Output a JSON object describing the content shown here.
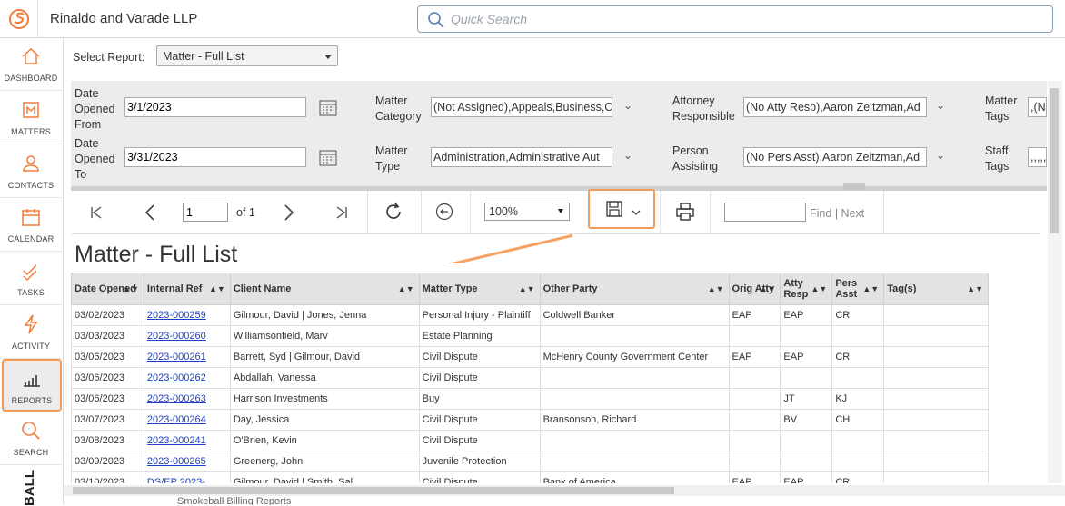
{
  "app": {
    "firm_name": "Rinaldo and Varade LLP",
    "search_placeholder": "Quick Search",
    "brand_vertical": "BALL"
  },
  "nav": [
    {
      "label": "DASHBOARD",
      "icon": "home-icon"
    },
    {
      "label": "MATTERS",
      "icon": "matters-icon"
    },
    {
      "label": "CONTACTS",
      "icon": "contacts-icon"
    },
    {
      "label": "CALENDAR",
      "icon": "calendar-icon"
    },
    {
      "label": "TASKS",
      "icon": "tasks-icon"
    },
    {
      "label": "ACTIVITY",
      "icon": "activity-icon"
    },
    {
      "label": "REPORTS",
      "icon": "reports-icon",
      "active": true
    },
    {
      "label": "SEARCH",
      "icon": "search-icon"
    }
  ],
  "report": {
    "select_label": "Select Report:",
    "selected": "Matter - Full List",
    "title": "Matter - Full List"
  },
  "filters": {
    "date_from_label": "Date Opened From",
    "date_from": "3/1/2023",
    "date_to_label": "Date Opened To",
    "date_to": "3/31/2023",
    "category_label": "Matter Category",
    "category": "(Not Assigned),Appeals,Business,C",
    "type_label": "Matter Type",
    "type": "Administration,Administrative Aut",
    "attorney_label": "Attorney Responsible",
    "attorney": "(No Atty Resp),Aaron Zeitzman,Ad",
    "person_label": "Person Assisting",
    "person": "(No Pers Asst),Aaron Zeitzman,Ad",
    "tags_label": "Matter Tags",
    "tags": ",(N",
    "staff_label": "Staff Tags",
    "staff": ",,,,,,,"
  },
  "toolbar": {
    "page": "1",
    "of": "of 1",
    "zoom": "100%",
    "find_label": "Find",
    "sep": "|",
    "next_label": "Next"
  },
  "table": {
    "headers": [
      "Date Opened",
      "Internal Ref",
      "Client Name",
      "Matter Type",
      "Other Party",
      "Orig Atty",
      "Atty Resp",
      "Pers Asst",
      "Tag(s)"
    ],
    "rows": [
      [
        "03/02/2023",
        "2023-000259",
        "Gilmour, David | Jones, Jenna",
        "Personal Injury - Plaintiff",
        "Coldwell Banker",
        "EAP",
        "EAP",
        "CR",
        ""
      ],
      [
        "03/03/2023",
        "2023-000260",
        "Williamsonfield, Marv",
        "Estate Planning",
        "",
        "",
        "",
        "",
        ""
      ],
      [
        "03/06/2023",
        "2023-000261",
        "Barrett, Syd | Gilmour, David",
        "Civil Dispute",
        "McHenry County Government Center",
        "EAP",
        "EAP",
        "CR",
        ""
      ],
      [
        "03/06/2023",
        "2023-000262",
        "Abdallah, Vanessa",
        "Civil Dispute",
        "",
        "",
        "",
        "",
        ""
      ],
      [
        "03/06/2023",
        "2023-000263",
        "Harrison Investments",
        "Buy",
        "",
        "",
        "JT",
        "KJ",
        ""
      ],
      [
        "03/07/2023",
        "2023-000264",
        "Day, Jessica",
        "Civil Dispute",
        "Bransonson, Richard",
        "",
        "BV",
        "CH",
        ""
      ],
      [
        "03/08/2023",
        "2023-000241",
        "O'Brien, Kevin",
        "Civil Dispute",
        "",
        "",
        "",
        "",
        ""
      ],
      [
        "03/09/2023",
        "2023-000265",
        "Greenerg, John",
        "Juvenile Protection",
        "",
        "",
        "",
        "",
        ""
      ],
      [
        "03/10/2023",
        "DS/EP 2023-",
        "Gilmour, David | Smith, Sal",
        "Civil Dispute",
        "Bank of America",
        "EAP",
        "EAP",
        "CR",
        ""
      ]
    ]
  },
  "footer": {
    "text": "Smokeball Billing Reports"
  },
  "colors": {
    "accent": "#f29a5a",
    "link": "#1a3fc4"
  }
}
